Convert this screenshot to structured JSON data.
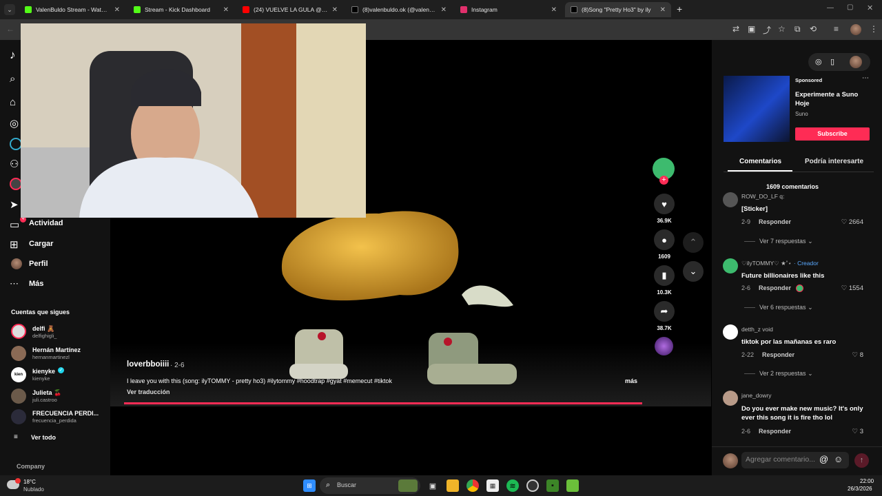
{
  "tabs": [
    {
      "title": "ValenBuldo Stream - Watch Live",
      "icon": "kick-icon",
      "color": "#53fc18"
    },
    {
      "title": "Stream - Kick Dashboard",
      "icon": "kick-icon",
      "color": "#53fc18"
    },
    {
      "title": "(24) VUELVE LA GULA @meliann",
      "icon": "youtube-icon",
      "color": "#ff0000"
    },
    {
      "title": "(8)valenbuldo.ok (@valenbuldo)",
      "icon": "tiktok-icon",
      "color": "#000000"
    },
    {
      "title": "Instagram",
      "icon": "instagram-icon",
      "color": "#e1306c"
    },
    {
      "title": "(8)Song \"Pretty Ho3\" by ily",
      "icon": "tiktok-icon",
      "color": "#000000"
    }
  ],
  "sidebar": {
    "items": [
      {
        "label": "Actividad",
        "icon": "inbox-icon",
        "badge": "4"
      },
      {
        "label": "Cargar",
        "icon": "upload-icon"
      },
      {
        "label": "Perfil",
        "icon": "profile-avatar"
      },
      {
        "label": "Más",
        "icon": "more-icon"
      }
    ],
    "following_title": "Cuentas que sigues",
    "following": [
      {
        "name": "delfi 🧸",
        "user": "delfighigli_"
      },
      {
        "name": "Hernán Martínez",
        "user": "hernanmartinezl"
      },
      {
        "name": "kienyke",
        "user": "kienyke"
      },
      {
        "name": "Julieta 🍒",
        "user": "juli.castroo"
      },
      {
        "name": "FRECUENCIA PERDI...",
        "user": "frecuencia_perdida"
      }
    ],
    "see_all": "Ver todo",
    "company": "Company"
  },
  "video": {
    "author": "loverbboiiii",
    "date": "· 2-6",
    "caption": "I leave you with this (song: ilyTOMMY - pretty ho3) #ilytommy #hoodtrap #gyat #memecut #tiktok",
    "more": "más",
    "translate": "Ver traducción",
    "progress": 1.0
  },
  "actions": {
    "likes": "36.9K",
    "comments": "1609",
    "saves": "10.3K",
    "shares": "38.7K"
  },
  "ad": {
    "sponsored": "Sponsored",
    "title": "Experimente a Suno Hoje",
    "brand": "Suno",
    "cta": "Subscribe"
  },
  "comments_panel": {
    "tab_comments": "Comentarios",
    "tab_interest": "Podría interesarte",
    "count": "1609 comentarios",
    "reply_label": "Responder",
    "items": [
      {
        "user": "ROW_DO_LF q:",
        "text": "[Sticker]",
        "date": "2-9",
        "likes": "2664",
        "more": "Ver 7 respuestas"
      },
      {
        "user": "♡ilyTOMMY♡ ★˚⋆",
        "creator": "· Creador",
        "text": "Future billionaires like this",
        "date": "2-6",
        "likes": "1554",
        "more": "Ver 6 respuestas"
      },
      {
        "user": "detth_z void",
        "text": "tiktok por las mañanas es raro",
        "date": "2-22",
        "likes": "8",
        "more": "Ver 2 respuestas"
      },
      {
        "user": "jane_dowry",
        "text": "Do you ever make new music? It's only ever this song it is fire tho lol",
        "date": "2-6",
        "likes": "3"
      }
    ],
    "input_placeholder": "Agregar comentario..."
  },
  "taskbar": {
    "weather_temp": "18°C",
    "weather_desc": "Nublado",
    "search_label": "Buscar",
    "time": "22:00",
    "date": "26/3/2026"
  }
}
